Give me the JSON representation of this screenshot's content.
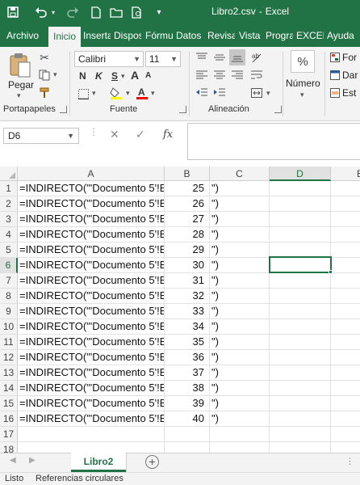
{
  "window": {
    "title": "Libro2.csv",
    "title_sep": "-",
    "app": "Excel"
  },
  "ribbon_tabs": [
    "Archivo",
    "Inicio",
    "Inserta",
    "Dispos",
    "Fórmu",
    "Datos",
    "Revisa",
    "Vista",
    "Progra",
    "EXCEL",
    "Ayuda"
  ],
  "active_tab": "Inicio",
  "clipboard": {
    "paste_label": "Pegar",
    "group_label": "Portapapeles"
  },
  "font": {
    "name": "Calibri",
    "size": "11",
    "bold": "N",
    "italic": "K",
    "underline": "S",
    "grow": "A",
    "shrink": "A",
    "group_label": "Fuente",
    "fill_color": "#ffff00",
    "font_color": "#ff0000"
  },
  "alignment": {
    "group_label": "Alineación"
  },
  "number": {
    "percent_symbol": "%",
    "label": "Número"
  },
  "styles": {
    "items": [
      "For",
      "Dar",
      "Est"
    ]
  },
  "formula_bar": {
    "name_box": "D6",
    "fx_label": "fx",
    "content": ""
  },
  "grid": {
    "columns": [
      "A",
      "B",
      "C",
      "D",
      "E"
    ],
    "selected_column": "D",
    "selected_row": 6,
    "active_cell": "D6",
    "rows": [
      {
        "num": "1",
        "a": "=INDIRECTO(\"'Documento 5'!B",
        "b": "25",
        "c": "\")"
      },
      {
        "num": "2",
        "a": "=INDIRECTO(\"'Documento 5'!B",
        "b": "26",
        "c": "\")"
      },
      {
        "num": "3",
        "a": "=INDIRECTO(\"'Documento 5'!B",
        "b": "27",
        "c": "\")"
      },
      {
        "num": "4",
        "a": "=INDIRECTO(\"'Documento 5'!B",
        "b": "28",
        "c": "\")"
      },
      {
        "num": "5",
        "a": "=INDIRECTO(\"'Documento 5'!B",
        "b": "29",
        "c": "\")"
      },
      {
        "num": "6",
        "a": "=INDIRECTO(\"'Documento 5'!B",
        "b": "30",
        "c": "\")"
      },
      {
        "num": "7",
        "a": "=INDIRECTO(\"'Documento 5'!B",
        "b": "31",
        "c": "\")"
      },
      {
        "num": "8",
        "a": "=INDIRECTO(\"'Documento 5'!B",
        "b": "32",
        "c": "\")"
      },
      {
        "num": "9",
        "a": "=INDIRECTO(\"'Documento 5'!B",
        "b": "33",
        "c": "\")"
      },
      {
        "num": "10",
        "a": "=INDIRECTO(\"'Documento 5'!B",
        "b": "34",
        "c": "\")"
      },
      {
        "num": "11",
        "a": "=INDIRECTO(\"'Documento 5'!B",
        "b": "35",
        "c": "\")"
      },
      {
        "num": "12",
        "a": "=INDIRECTO(\"'Documento 5'!B",
        "b": "36",
        "c": "\")"
      },
      {
        "num": "13",
        "a": "=INDIRECTO(\"'Documento 5'!B",
        "b": "37",
        "c": "\")"
      },
      {
        "num": "14",
        "a": "=INDIRECTO(\"'Documento 5'!B",
        "b": "38",
        "c": "\")"
      },
      {
        "num": "15",
        "a": "=INDIRECTO(\"'Documento 5'!B",
        "b": "39",
        "c": "\")"
      },
      {
        "num": "16",
        "a": "=INDIRECTO(\"'Documento 5'!B",
        "b": "40",
        "c": "\")"
      },
      {
        "num": "17",
        "a": "",
        "b": "",
        "c": ""
      },
      {
        "num": "18",
        "a": "",
        "b": "",
        "c": ""
      }
    ]
  },
  "sheets": {
    "active": "Libro2",
    "add_symbol": "+"
  },
  "status_bar": {
    "ready": "Listo",
    "circular": "Referencias circulares"
  },
  "colors": {
    "accent": "#217346",
    "ribbon_bg": "#f3f3f3"
  }
}
